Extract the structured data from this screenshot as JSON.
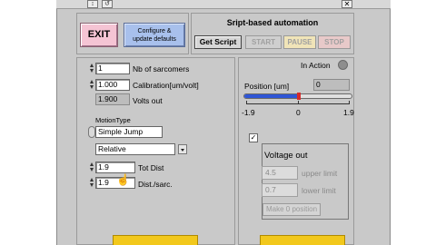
{
  "titlebar": {
    "icon_labels": [
      "↕",
      "↺"
    ],
    "close_label": "✕"
  },
  "top": {
    "exit_label": "EXIT",
    "config_label_1": "Configure &",
    "config_label_2": "update defaults",
    "exit_color": "#f5c4d4",
    "config_color": "#a8c0ec"
  },
  "script": {
    "title": "Sript-based automation",
    "get_script_label": "Get Script",
    "start_label": "START",
    "pause_label": "PAUSE",
    "stop_label": "STOP",
    "pause_color": "#f0e4b8",
    "stop_color": "#e8c9c9"
  },
  "left": {
    "sarcomers": {
      "value": "1",
      "label": "Nb of sarcomers"
    },
    "calibration": {
      "value": "1.000",
      "label": "Calibration[um/volt]"
    },
    "volts_out": {
      "value": "1.900",
      "label": "Volts out"
    },
    "motion_type_label": "MotionType",
    "motion_type_value": "Simple Jump",
    "mode_value": "Relative",
    "tot_dist": {
      "value": "1.9",
      "label": "Tot Dist"
    },
    "dist_sarc": {
      "value": "1.9",
      "label": "Dist./sarc."
    }
  },
  "right": {
    "in_action_label": "In Action",
    "position_label": "Position [um]",
    "position_value": "0",
    "slider": {
      "min_label": "-1.9",
      "mid_label": "0",
      "max_label": "1.9",
      "value": 0,
      "min": -1.9,
      "max": 1.9
    },
    "checkbox_mark": "✓",
    "voltage_title": "Voltage out",
    "upper": {
      "value": "4.5",
      "label": "upper limit"
    },
    "lower": {
      "value": "0.7",
      "label": "lower limit"
    },
    "make_zero_label": "Make 0 position"
  },
  "colors": {
    "slider_fill": "#2f56d6",
    "slider_thumb": "#d62a2a",
    "bottom_button": "#f2c81c"
  }
}
